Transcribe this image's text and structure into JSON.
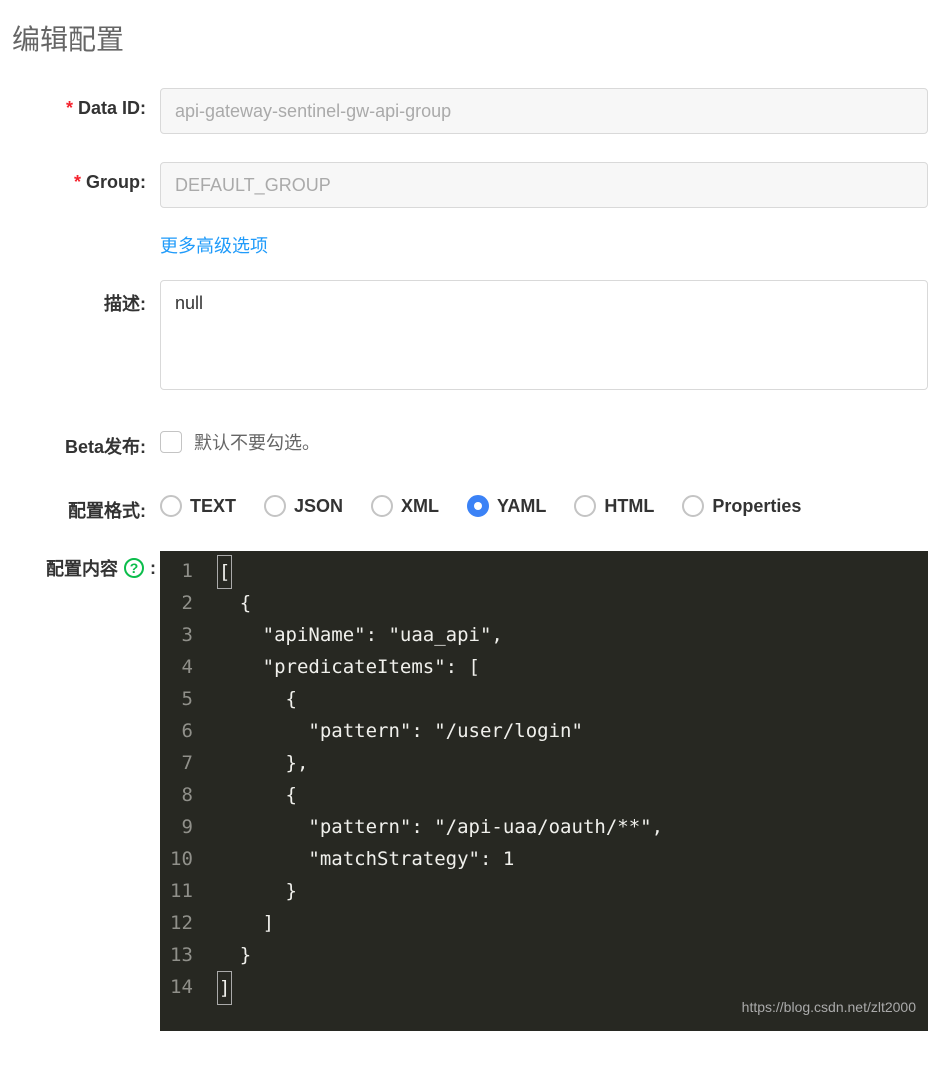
{
  "page_title": "编辑配置",
  "labels": {
    "data_id": "Data ID:",
    "group": "Group:",
    "description": "描述:",
    "beta_publish": "Beta发布:",
    "config_format": "配置格式:",
    "config_content": "配置内容",
    "colon": ":"
  },
  "inputs": {
    "data_id_value": "api-gateway-sentinel-gw-api-group",
    "group_value": "DEFAULT_GROUP",
    "description_value": "null"
  },
  "links": {
    "advanced_options": "更多高级选项"
  },
  "beta": {
    "hint": "默认不要勾选。",
    "checked": false
  },
  "format_options": [
    {
      "key": "text",
      "label": "TEXT",
      "selected": false
    },
    {
      "key": "json",
      "label": "JSON",
      "selected": false
    },
    {
      "key": "xml",
      "label": "XML",
      "selected": false
    },
    {
      "key": "yaml",
      "label": "YAML",
      "selected": true
    },
    {
      "key": "html",
      "label": "HTML",
      "selected": false
    },
    {
      "key": "properties",
      "label": "Properties",
      "selected": false
    }
  ],
  "editor": {
    "lines": [
      "[",
      "  {",
      "    \"apiName\": \"uaa_api\",",
      "    \"predicateItems\": [",
      "      {",
      "        \"pattern\": \"/user/login\"",
      "      },",
      "      {",
      "        \"pattern\": \"/api-uaa/oauth/**\",",
      "        \"matchStrategy\": 1",
      "      }",
      "    ]",
      "  }",
      "]"
    ]
  },
  "watermark": "https://blog.csdn.net/zlt2000"
}
